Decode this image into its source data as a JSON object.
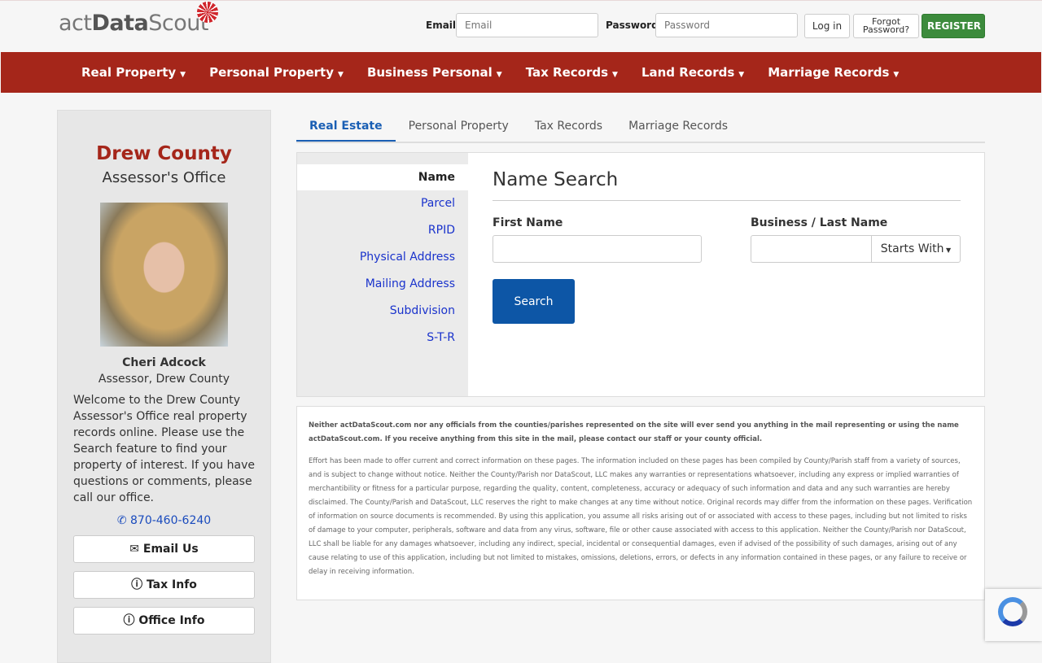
{
  "header": {
    "logo_pre": "act",
    "logo_bold": "Data",
    "logo_post": "Scout",
    "email_label": "Email",
    "email_placeholder": "Email",
    "password_label": "Password",
    "password_placeholder": "Password",
    "login": "Log in",
    "forgot": "Forgot Password?",
    "register": "REGISTER"
  },
  "nav": [
    "Real Property",
    "Personal Property",
    "Business Personal",
    "Tax Records",
    "Land Records",
    "Marriage Records"
  ],
  "sidebar": {
    "county": "Drew County",
    "office": "Assessor's Office",
    "name": "Cheri Adcock",
    "title": "Assessor, Drew County",
    "welcome": "Welcome to the Drew County Assessor's Office real property records online. Please use the Search feature to find your property of interest. If you have questions or comments, please call our office.",
    "phone": "870-460-6240",
    "buttons": [
      "Email Us",
      "Tax Info",
      "Office Info"
    ]
  },
  "tabs": [
    "Real Estate",
    "Personal Property",
    "Tax Records",
    "Marriage Records"
  ],
  "search": {
    "nav": [
      "Name",
      "Parcel",
      "RPID",
      "Physical Address",
      "Mailing Address",
      "Subdivision",
      "S-T-R"
    ],
    "title": "Name Search",
    "first_label": "First Name",
    "last_label": "Business / Last Name",
    "mode": "Starts With",
    "button": "Search"
  },
  "disclaimer": {
    "bold": "Neither actDataScout.com nor any officials from the counties/parishes represented on the site will ever send you anything in the mail representing or using the name actDataScout.com. If you receive anything from this site in the mail, please contact our staff or your county official.",
    "body": "Effort has been made to offer current and correct information on these pages. The information included on these pages has been compiled by County/Parish staff from a variety of sources, and is subject to change without notice. Neither the County/Parish nor DataScout, LLC makes any warranties or representations whatsoever, including any express or implied warranties of merchantibility or fitness for a particular purpose, regarding the quality, content, completeness, accuracy or adequacy of such information and data and any such warranties are hereby disclaimed. The County/Parish and DataScout, LLC reserves the right to make changes at any time without notice. Original records may differ from the information on these pages. Verification of information on source documents is recommended. By using this application, you assume all risks arising out of or associated with access to these pages, including but not limited to risks of damage to your computer, peripherals, software and data from any virus, software, file or other cause associated with access to this application. Neither the County/Parish nor DataScout, LLC shall be liable for any damages whatsoever, including any indirect, special, incidental or consequential damages, even if advised of the possibility of such damages, arising out of any cause relating to use of this application, including but not limited to mistakes, omissions, deletions, errors, or defects in any information contained in these pages, or any failure to receive or delay in receiving information."
  }
}
